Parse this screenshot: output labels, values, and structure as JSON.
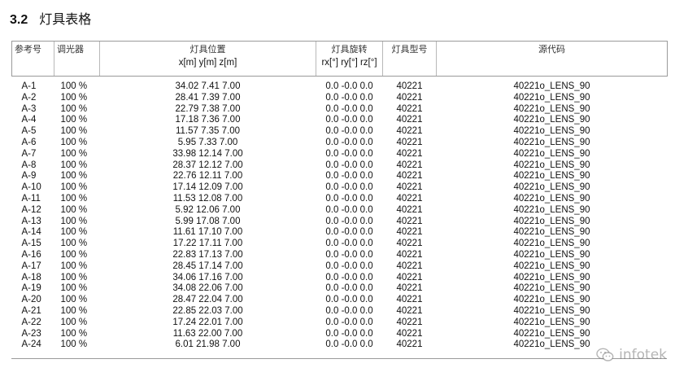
{
  "section": {
    "number": "3.2",
    "title": "灯具表格"
  },
  "table": {
    "headers": {
      "ref": "参考号",
      "dim": "调光器",
      "pos": "灯具位置",
      "pos_sub": "x[m] y[m] z[m]",
      "rot": "灯具旋转",
      "rot_sub": "rx[°] ry[°] rz[°]",
      "type": "灯具型号",
      "code": "源代码"
    },
    "rows": [
      {
        "ref": "A-1",
        "dim": "100 %",
        "pos": "34.02 7.41 7.00",
        "rot": "0.0 -0.0 0.0",
        "type": "40221",
        "code": "40221o_LENS_90"
      },
      {
        "ref": "A-2",
        "dim": "100 %",
        "pos": "28.41 7.39 7.00",
        "rot": "0.0 -0.0 0.0",
        "type": "40221",
        "code": "40221o_LENS_90"
      },
      {
        "ref": "A-3",
        "dim": "100 %",
        "pos": "22.79 7.38 7.00",
        "rot": "0.0 -0.0 0.0",
        "type": "40221",
        "code": "40221o_LENS_90"
      },
      {
        "ref": "A-4",
        "dim": "100 %",
        "pos": "17.18 7.36 7.00",
        "rot": "0.0 -0.0 0.0",
        "type": "40221",
        "code": "40221o_LENS_90"
      },
      {
        "ref": "A-5",
        "dim": "100 %",
        "pos": "11.57 7.35 7.00",
        "rot": "0.0 -0.0 0.0",
        "type": "40221",
        "code": "40221o_LENS_90"
      },
      {
        "ref": "A-6",
        "dim": "100 %",
        "pos": "5.95 7.33 7.00",
        "rot": "0.0 -0.0 0.0",
        "type": "40221",
        "code": "40221o_LENS_90"
      },
      {
        "ref": "A-7",
        "dim": "100 %",
        "pos": "33.98 12.14 7.00",
        "rot": "0.0 -0.0 0.0",
        "type": "40221",
        "code": "40221o_LENS_90"
      },
      {
        "ref": "A-8",
        "dim": "100 %",
        "pos": "28.37 12.12 7.00",
        "rot": "0.0 -0.0 0.0",
        "type": "40221",
        "code": "40221o_LENS_90"
      },
      {
        "ref": "A-9",
        "dim": "100 %",
        "pos": "22.76 12.11 7.00",
        "rot": "0.0 -0.0 0.0",
        "type": "40221",
        "code": "40221o_LENS_90"
      },
      {
        "ref": "A-10",
        "dim": "100 %",
        "pos": "17.14 12.09 7.00",
        "rot": "0.0 -0.0 0.0",
        "type": "40221",
        "code": "40221o_LENS_90"
      },
      {
        "ref": "A-11",
        "dim": "100 %",
        "pos": "11.53 12.08 7.00",
        "rot": "0.0 -0.0 0.0",
        "type": "40221",
        "code": "40221o_LENS_90"
      },
      {
        "ref": "A-12",
        "dim": "100 %",
        "pos": "5.92 12.06 7.00",
        "rot": "0.0 -0.0 0.0",
        "type": "40221",
        "code": "40221o_LENS_90"
      },
      {
        "ref": "A-13",
        "dim": "100 %",
        "pos": "5.99 17.08 7.00",
        "rot": "0.0 -0.0 0.0",
        "type": "40221",
        "code": "40221o_LENS_90"
      },
      {
        "ref": "A-14",
        "dim": "100 %",
        "pos": "11.61 17.10 7.00",
        "rot": "0.0 -0.0 0.0",
        "type": "40221",
        "code": "40221o_LENS_90"
      },
      {
        "ref": "A-15",
        "dim": "100 %",
        "pos": "17.22 17.11 7.00",
        "rot": "0.0 -0.0 0.0",
        "type": "40221",
        "code": "40221o_LENS_90"
      },
      {
        "ref": "A-16",
        "dim": "100 %",
        "pos": "22.83 17.13 7.00",
        "rot": "0.0 -0.0 0.0",
        "type": "40221",
        "code": "40221o_LENS_90"
      },
      {
        "ref": "A-17",
        "dim": "100 %",
        "pos": "28.45 17.14 7.00",
        "rot": "0.0 -0.0 0.0",
        "type": "40221",
        "code": "40221o_LENS_90"
      },
      {
        "ref": "A-18",
        "dim": "100 %",
        "pos": "34.06 17.16 7.00",
        "rot": "0.0 -0.0 0.0",
        "type": "40221",
        "code": "40221o_LENS_90"
      },
      {
        "ref": "A-19",
        "dim": "100 %",
        "pos": "34.08 22.06 7.00",
        "rot": "0.0 -0.0 0.0",
        "type": "40221",
        "code": "40221o_LENS_90"
      },
      {
        "ref": "A-20",
        "dim": "100 %",
        "pos": "28.47 22.04 7.00",
        "rot": "0.0 -0.0 0.0",
        "type": "40221",
        "code": "40221o_LENS_90"
      },
      {
        "ref": "A-21",
        "dim": "100 %",
        "pos": "22.85 22.03 7.00",
        "rot": "0.0 -0.0 0.0",
        "type": "40221",
        "code": "40221o_LENS_90"
      },
      {
        "ref": "A-22",
        "dim": "100 %",
        "pos": "17.24 22.01 7.00",
        "rot": "0.0 -0.0 0.0",
        "type": "40221",
        "code": "40221o_LENS_90"
      },
      {
        "ref": "A-23",
        "dim": "100 %",
        "pos": "11.63 22.00 7.00",
        "rot": "0.0 -0.0 0.0",
        "type": "40221",
        "code": "40221o_LENS_90"
      },
      {
        "ref": "A-24",
        "dim": "100 %",
        "pos": "6.01 21.98 7.00",
        "rot": "0.0 -0.0 0.0",
        "type": "40221",
        "code": "40221o_LENS_90"
      }
    ]
  },
  "watermark": {
    "text": "infotek",
    "icon": "wechat-icon"
  }
}
